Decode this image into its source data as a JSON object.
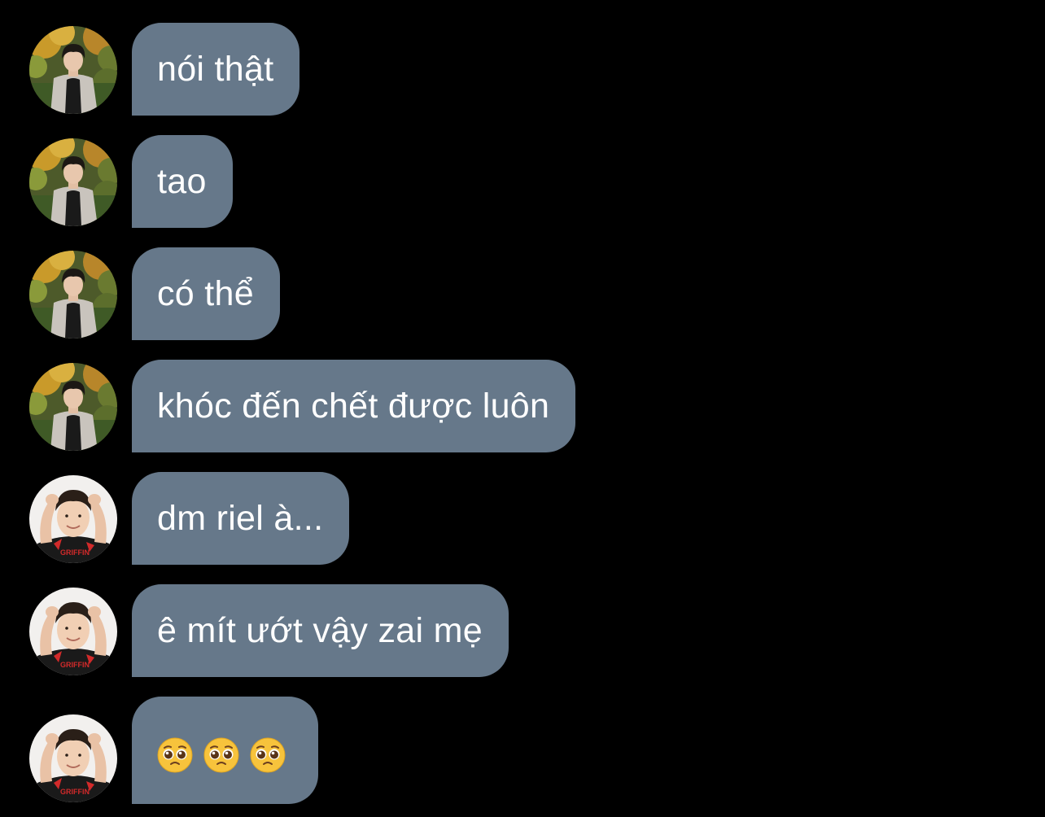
{
  "colors": {
    "background": "#000000",
    "bubble": "#66788a",
    "text": "#ffffff"
  },
  "messages": [
    {
      "sender": "user-a",
      "avatar_icon": "avatar-photo-a",
      "text": "nói thật"
    },
    {
      "sender": "user-a",
      "avatar_icon": "avatar-photo-a",
      "text": "tao"
    },
    {
      "sender": "user-a",
      "avatar_icon": "avatar-photo-a",
      "text": "có thể"
    },
    {
      "sender": "user-a",
      "avatar_icon": "avatar-photo-a",
      "text": "khóc đến chết được luôn"
    },
    {
      "sender": "user-b",
      "avatar_icon": "avatar-photo-b",
      "text": "dm riel à..."
    },
    {
      "sender": "user-b",
      "avatar_icon": "avatar-photo-b",
      "text": "ê mít ướt vậy zai mẹ"
    },
    {
      "sender": "user-b",
      "avatar_icon": "avatar-photo-b",
      "emoji": [
        "pleading-face-icon",
        "pleading-face-icon",
        "pleading-face-icon"
      ]
    }
  ],
  "avatar_b_jersey_text": "GRIFFIN"
}
